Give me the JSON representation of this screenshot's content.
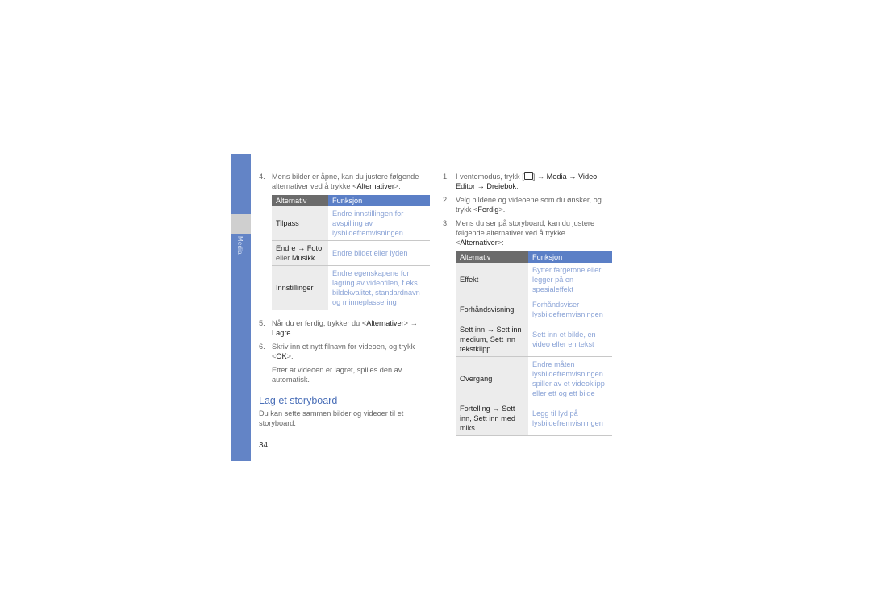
{
  "sidebar": {
    "section_label": "Media"
  },
  "left": {
    "step4": {
      "num": "4.",
      "text_a": "Mens bilder er åpne, kan du justere følgende alternativer ved å trykke <",
      "bold": "Alternativer",
      "text_b": ">:"
    },
    "table1": {
      "headers": [
        "Alternativ",
        "Funksjon"
      ],
      "rows": [
        {
          "option_a": "Tilpass",
          "option_sep": "",
          "option_b": "",
          "desc": "Endre innstillingen for avspilling av lysbildefremvisningen"
        },
        {
          "option_a": "Endre → Foto",
          "option_sep": " eller ",
          "option_b": "Musikk",
          "desc": "Endre bildet eller lyden"
        },
        {
          "option_a": "Innstillinger",
          "option_sep": "",
          "option_b": "",
          "desc": "Endre egenskapene for lagring av videofilen, f.eks. bildekvalitet, standardnavn og minneplassering"
        }
      ]
    },
    "step5": {
      "num": "5.",
      "text_a": "Når du er ferdig, trykker du <",
      "bold1": "Alternativer",
      "text_b": "> → ",
      "bold2": "Lagre",
      "text_c": "."
    },
    "step6": {
      "num": "6.",
      "text_a": "Skriv inn et nytt filnavn for videoen, og trykk <",
      "bold": "OK",
      "text_b": ">."
    },
    "note": "Etter at videoen er lagret, spilles den av automatisk.",
    "heading": "Lag et storyboard",
    "intro": "Du kan sette sammen bilder og videoer til et storyboard."
  },
  "right": {
    "step1": {
      "num": "1.",
      "text_a": "I ventemodus, trykk [",
      "text_b": "] → ",
      "bold1": "Media",
      "arrow": " → ",
      "bold2": "Video Editor",
      "arrow2": " → ",
      "bold3": "Dreiebok",
      "text_c": "."
    },
    "step2": {
      "num": "2.",
      "text_a": "Velg bildene og videoene som du ønsker, og trykk <",
      "bold": "Ferdig",
      "text_b": ">."
    },
    "step3": {
      "num": "3.",
      "text_a": "Mens du ser på storyboard, kan du justere følgende alternativer ved å trykke <",
      "bold": "Alternativer",
      "text_b": ">:"
    },
    "table2": {
      "headers": [
        "Alternativ",
        "Funksjon"
      ],
      "rows": [
        {
          "option": "Effekt",
          "desc": "Bytter fargetone eller legger på en spesialeffekt"
        },
        {
          "option": "Forhåndsvisning",
          "desc": "Forhåndsviser lysbildefremvisningen"
        },
        {
          "option": "Sett inn → Sett inn medium, Sett inn tekstklipp",
          "desc": "Sett inn et bilde, en video eller en tekst"
        },
        {
          "option": "Overgang",
          "desc": "Endre måten lysbildefremvisningen spiller av et videoklipp eller ett og ett bilde"
        },
        {
          "option": "Fortelling → Sett inn, Sett inn med miks",
          "desc": "Legg til lyd på lysbildefremvisningen"
        }
      ]
    }
  },
  "footer": {
    "page_number": "34"
  }
}
